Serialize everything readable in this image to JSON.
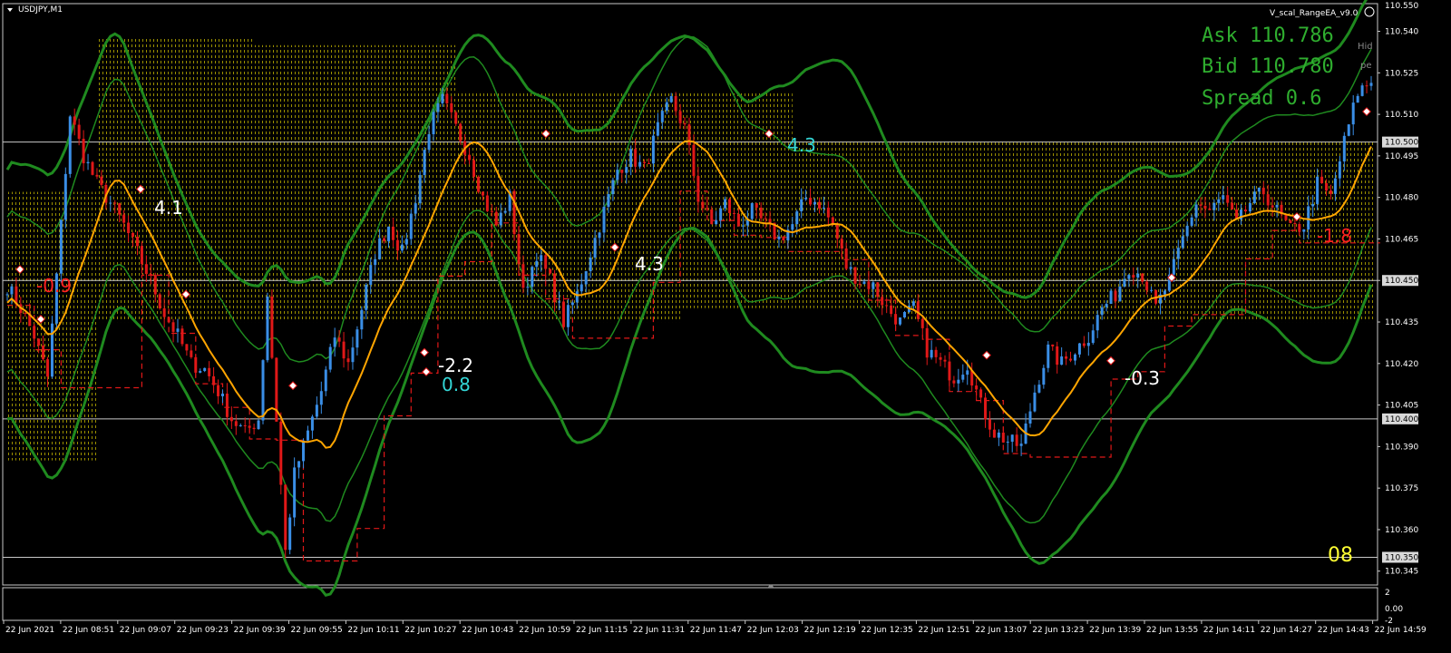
{
  "header": {
    "symbol": "USDJPY,M1",
    "ea_name": "V_scal_RangeEA_v9.0"
  },
  "quote": {
    "ask": "Ask 110.786",
    "bid": "Bid 110.780",
    "spread": "Spread 0.6"
  },
  "side_labels": [
    "Hid",
    "pe"
  ],
  "corner_label": "08",
  "trade_labels": [
    {
      "text": "-0.9",
      "color": "#ff2020"
    },
    {
      "text": "4.1",
      "color": "#ffffff"
    },
    {
      "text": "4.3",
      "color": "#ffffff"
    },
    {
      "text": "4.3",
      "color": "#33d6d6"
    },
    {
      "text": "-2.2",
      "color": "#ffffff"
    },
    {
      "text": "0.8",
      "color": "#33d6d6"
    },
    {
      "text": "-0.3",
      "color": "#ffffff"
    },
    {
      "text": "-1.8",
      "color": "#ff2020"
    }
  ],
  "sub_panel": {
    "ticks": [
      "2",
      "0.00",
      "-2"
    ]
  },
  "colors": {
    "bull": "#3a8ee6",
    "bear": "#e01818",
    "ma": "#ffa500",
    "bands": "#1f8a1f",
    "zone": "#b5a800",
    "stop": "#e01818"
  },
  "chart_data": {
    "type": "candlestick",
    "symbol": "USDJPY",
    "timeframe": "M1",
    "ylim": [
      110.34,
      110.55
    ],
    "price_ticks": [
      "110.540",
      "110.525",
      "110.510",
      "110.495",
      "110.480",
      "110.465",
      "110.450",
      "110.435",
      "110.420",
      "110.405",
      "110.390",
      "110.375",
      "110.360",
      "110.345"
    ],
    "highlighted_levels": [
      "110.500",
      "110.450",
      "110.400",
      "110.350"
    ],
    "top_price": "110.550",
    "time_labels": [
      "22 Jun 2021",
      "22 Jun 08:51",
      "22 Jun 09:07",
      "22 Jun 09:23",
      "22 Jun 09:39",
      "22 Jun 09:55",
      "22 Jun 10:11",
      "22 Jun 10:27",
      "22 Jun 10:43",
      "22 Jun 10:59",
      "22 Jun 11:15",
      "22 Jun 11:31",
      "22 Jun 11:47",
      "22 Jun 12:03",
      "22 Jun 12:19",
      "22 Jun 12:35",
      "22 Jun 12:51",
      "22 Jun 13:07",
      "22 Jun 13:23",
      "22 Jun 13:39",
      "22 Jun 13:55",
      "22 Jun 14:11",
      "22 Jun 14:27",
      "22 Jun 14:43",
      "22 Jun 14:59"
    ],
    "close_path": [
      [
        0,
        110.448
      ],
      [
        3,
        110.44
      ],
      [
        6,
        110.43
      ],
      [
        9,
        110.415
      ],
      [
        12,
        110.47
      ],
      [
        14,
        110.51
      ],
      [
        17,
        110.495
      ],
      [
        20,
        110.485
      ],
      [
        23,
        110.478
      ],
      [
        26,
        110.47
      ],
      [
        29,
        110.46
      ],
      [
        32,
        110.45
      ],
      [
        35,
        110.438
      ],
      [
        38,
        110.43
      ],
      [
        41,
        110.42
      ],
      [
        44,
        110.418
      ],
      [
        47,
        110.41
      ],
      [
        50,
        110.4
      ],
      [
        53,
        110.395
      ],
      [
        56,
        110.4
      ],
      [
        58,
        110.445
      ],
      [
        60,
        110.4
      ],
      [
        62,
        110.352
      ],
      [
        64,
        110.38
      ],
      [
        67,
        110.395
      ],
      [
        70,
        110.41
      ],
      [
        73,
        110.43
      ],
      [
        76,
        110.42
      ],
      [
        79,
        110.44
      ],
      [
        82,
        110.46
      ],
      [
        85,
        110.47
      ],
      [
        88,
        110.46
      ],
      [
        91,
        110.48
      ],
      [
        94,
        110.505
      ],
      [
        97,
        110.515
      ],
      [
        100,
        110.505
      ],
      [
        103,
        110.495
      ],
      [
        106,
        110.48
      ],
      [
        109,
        110.47
      ],
      [
        112,
        110.48
      ],
      [
        115,
        110.445
      ],
      [
        118,
        110.46
      ],
      [
        121,
        110.45
      ],
      [
        124,
        110.435
      ],
      [
        127,
        110.445
      ],
      [
        130,
        110.46
      ],
      [
        133,
        110.475
      ],
      [
        136,
        110.49
      ],
      [
        139,
        110.495
      ],
      [
        142,
        110.49
      ],
      [
        145,
        110.505
      ],
      [
        148,
        110.515
      ],
      [
        151,
        110.505
      ],
      [
        154,
        110.48
      ],
      [
        157,
        110.47
      ],
      [
        160,
        110.478
      ],
      [
        163,
        110.47
      ],
      [
        166,
        110.475
      ],
      [
        169,
        110.47
      ],
      [
        172,
        110.465
      ],
      [
        175,
        110.47
      ],
      [
        178,
        110.48
      ],
      [
        181,
        110.478
      ],
      [
        184,
        110.47
      ],
      [
        187,
        110.455
      ],
      [
        190,
        110.45
      ],
      [
        193,
        110.448
      ],
      [
        196,
        110.44
      ],
      [
        199,
        110.435
      ],
      [
        202,
        110.44
      ],
      [
        205,
        110.425
      ],
      [
        208,
        110.42
      ],
      [
        211,
        110.415
      ],
      [
        214,
        110.42
      ],
      [
        217,
        110.405
      ],
      [
        220,
        110.395
      ],
      [
        223,
        110.392
      ],
      [
        226,
        110.39
      ],
      [
        229,
        110.41
      ],
      [
        232,
        110.425
      ],
      [
        235,
        110.42
      ],
      [
        238,
        110.425
      ],
      [
        241,
        110.43
      ],
      [
        244,
        110.44
      ],
      [
        247,
        110.445
      ],
      [
        250,
        110.455
      ],
      [
        253,
        110.452
      ],
      [
        256,
        110.44
      ],
      [
        259,
        110.45
      ],
      [
        262,
        110.465
      ],
      [
        265,
        110.478
      ],
      [
        268,
        110.475
      ],
      [
        271,
        110.48
      ],
      [
        274,
        110.47
      ],
      [
        277,
        110.478
      ],
      [
        280,
        110.482
      ],
      [
        283,
        110.475
      ],
      [
        286,
        110.468
      ],
      [
        289,
        110.47
      ],
      [
        292,
        110.485
      ],
      [
        295,
        110.48
      ],
      [
        298,
        110.5
      ],
      [
        301,
        110.518
      ],
      [
        304,
        110.522
      ]
    ]
  }
}
